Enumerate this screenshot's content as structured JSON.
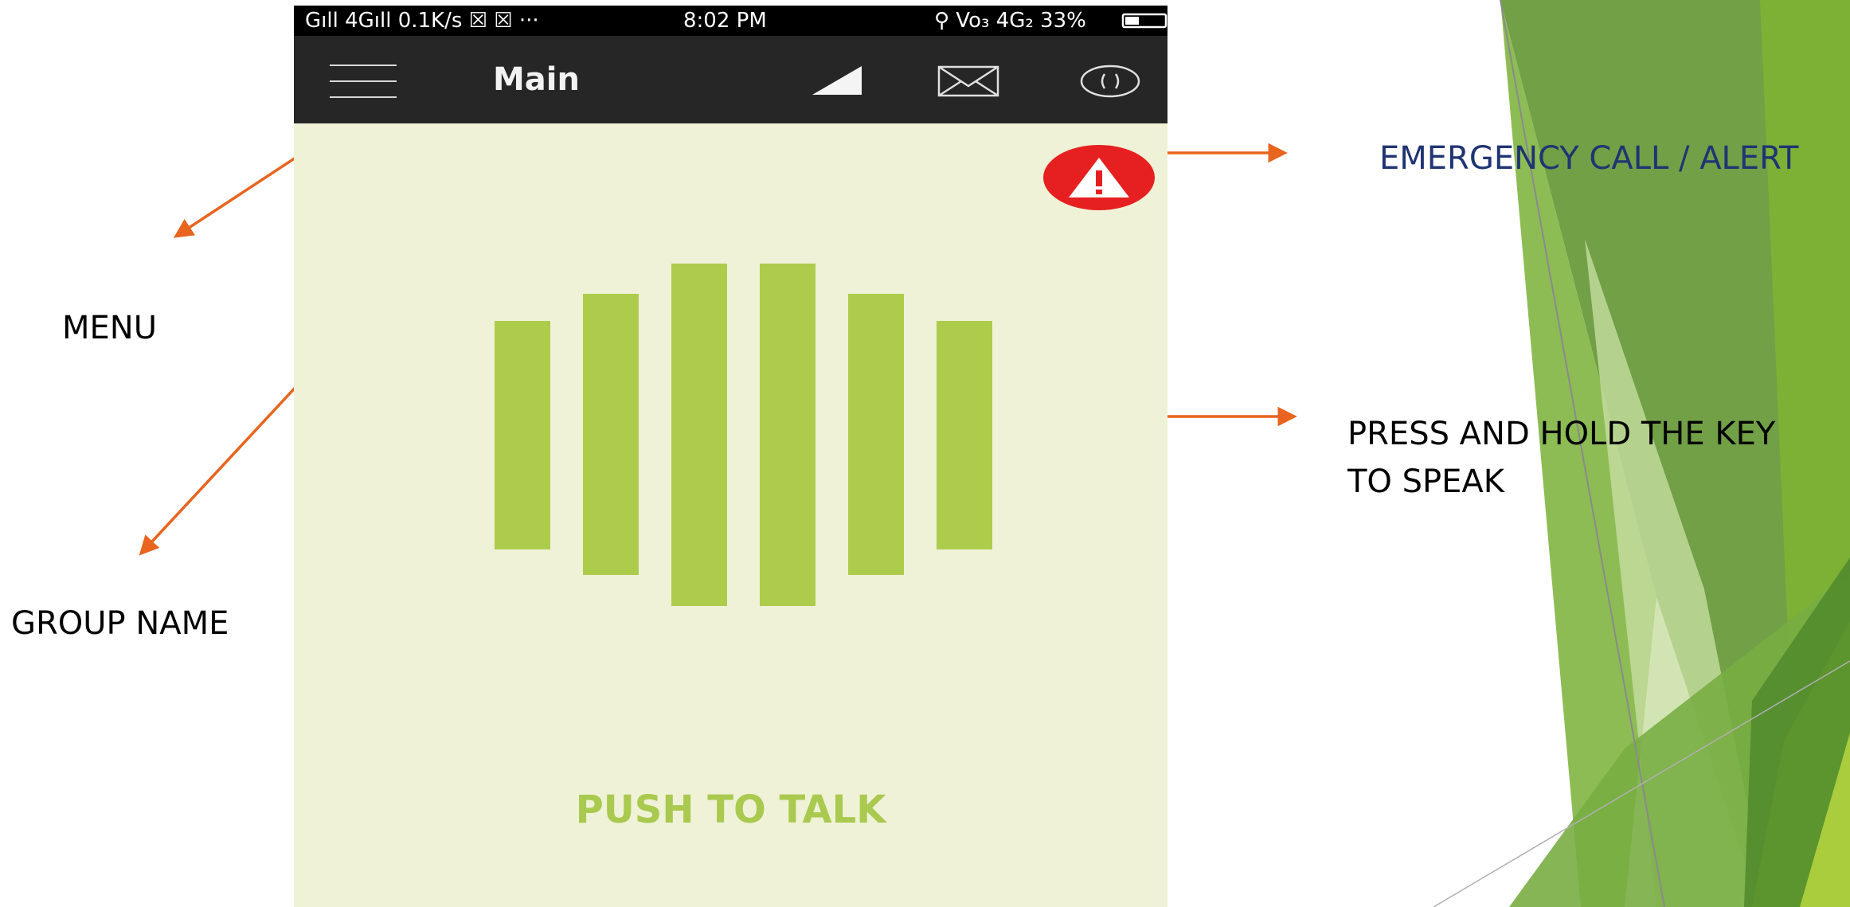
{
  "status_bar": {
    "left_text": "Gıll 4Gıll 0.1K/s ☒ ☒ ···",
    "time": "8:02 PM",
    "right_text": "⚲ Vo₃ 4G₂ 33%",
    "icons": [
      "signal-icon",
      "sim-icon",
      "location-icon",
      "battery-icon"
    ]
  },
  "app_bar": {
    "title": "Main",
    "icons": [
      "menu-icon",
      "signal-strength-icon",
      "mail-icon",
      "ring-icon"
    ]
  },
  "alert_button": {
    "icon": "warning-icon",
    "color": "#e62020"
  },
  "ptt": {
    "label": "PUSH TO TALK",
    "icon": "voice-bars-icon",
    "bar_color": "#aecc4c"
  },
  "annotations": {
    "menu": "MENU",
    "group_name": "GROUP NAME",
    "emergency": "EMERGENCY CALL / ALERT",
    "press_hold_line1": "PRESS AND HOLD THE KEY",
    "press_hold_line2": "TO SPEAK"
  },
  "colors": {
    "arrow": "#e8641f",
    "phone_background": "#eff2d6",
    "app_bar": "#262626",
    "status_bar": "#000000",
    "emergency_text": "#1f3473",
    "accent_green": "#6aa13c"
  }
}
